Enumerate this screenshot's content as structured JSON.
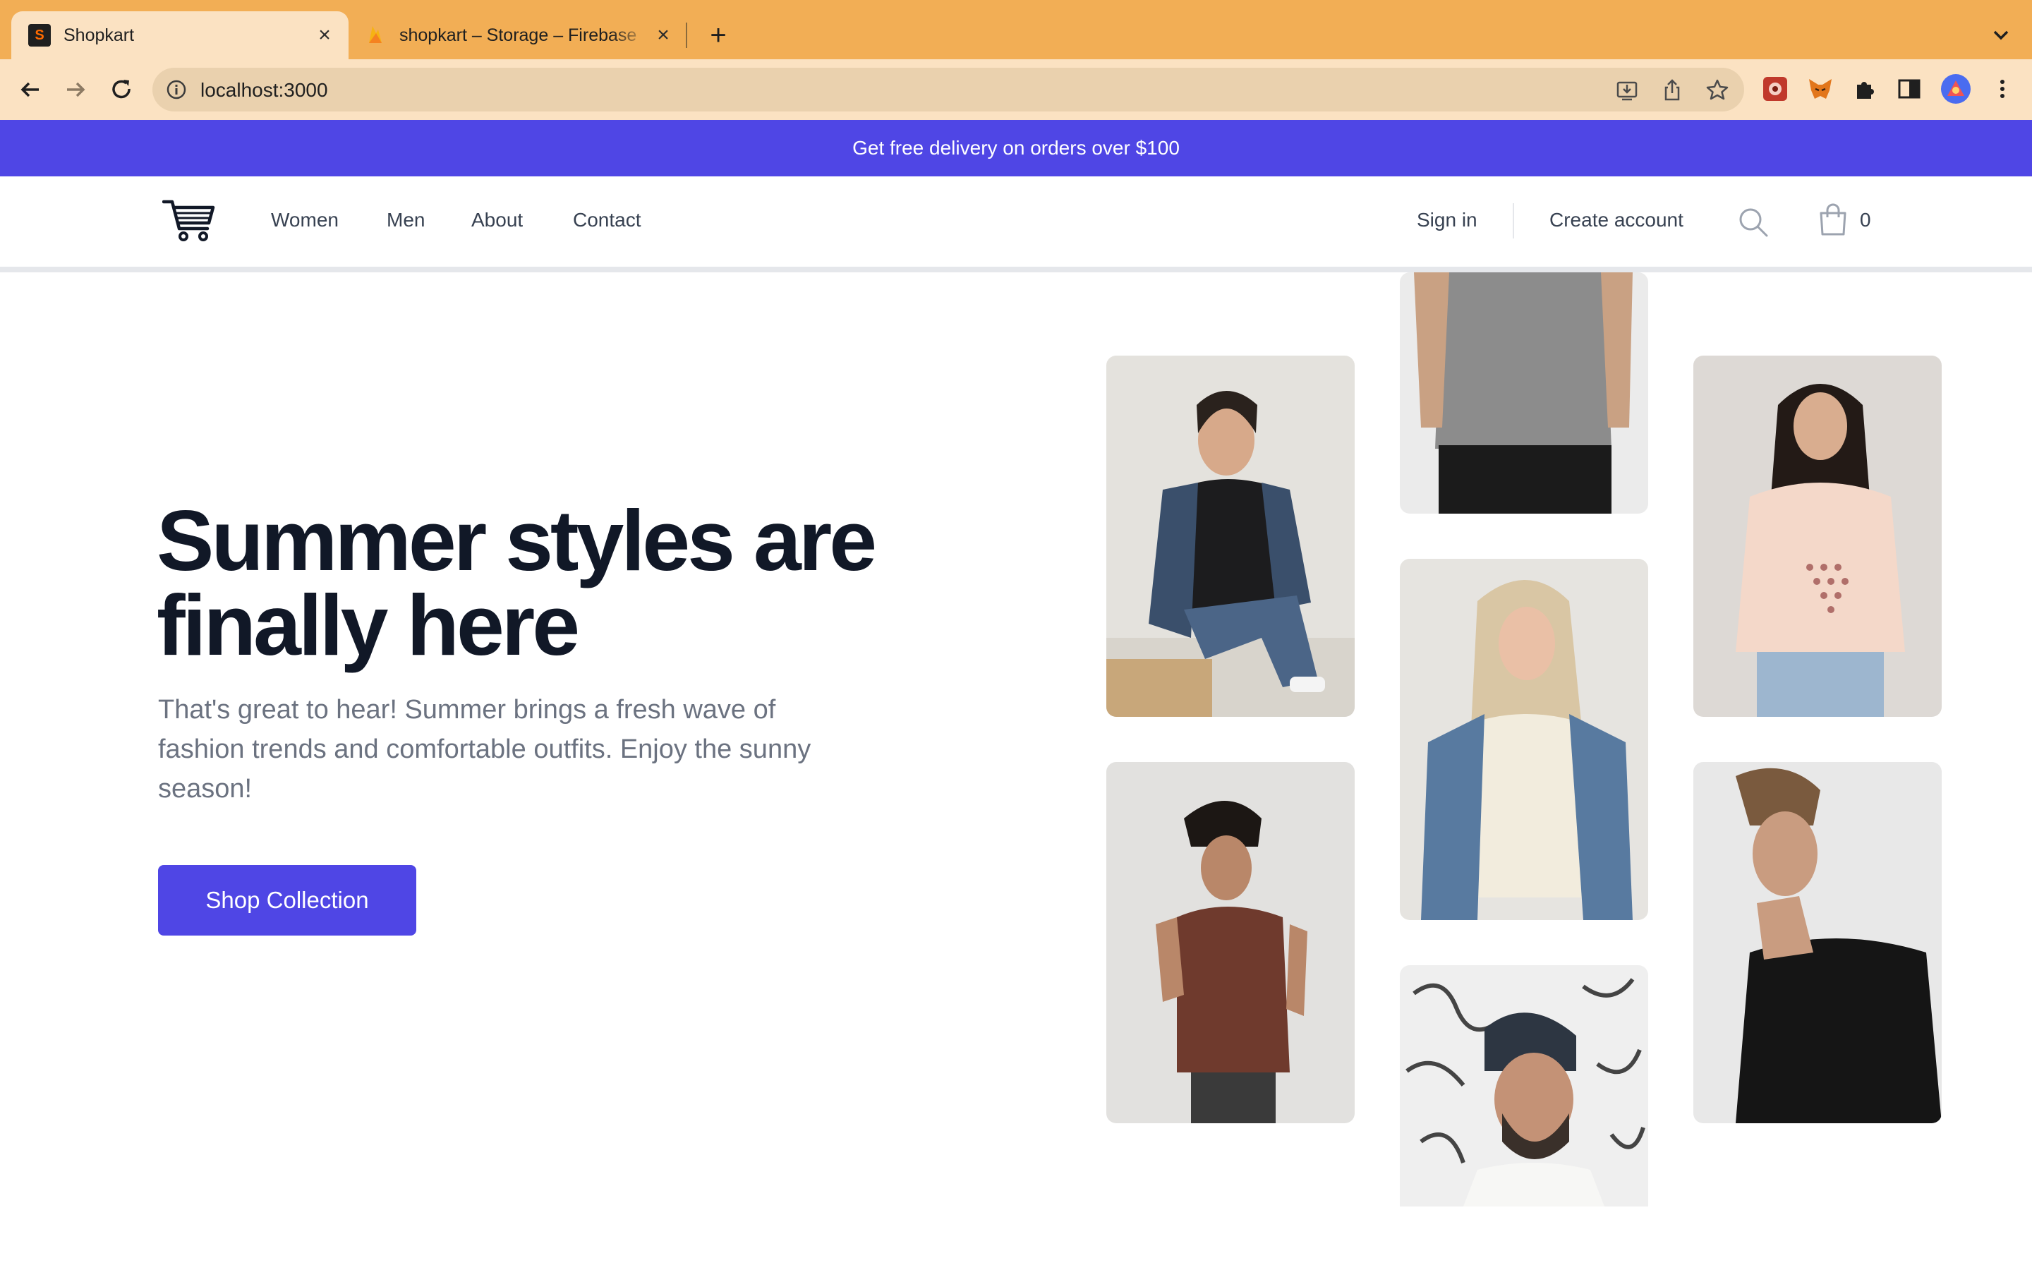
{
  "browser": {
    "tabs": [
      {
        "title": "Shopkart",
        "favicon": "S",
        "active": true
      },
      {
        "title": "shopkart – Storage – Firebase",
        "favicon": "firebase-flame",
        "active": false
      }
    ],
    "url": "localhost:3000",
    "accent_color": "#f2ae55"
  },
  "promo": {
    "text": "Get free delivery on orders over $100"
  },
  "nav": {
    "links": [
      "Women",
      "Men",
      "About",
      "Contact"
    ],
    "sign_in": "Sign in",
    "create_account": "Create account",
    "cart_count": "0"
  },
  "hero": {
    "title": "Summer styles are finally here",
    "description": "That's great to hear! Summer brings a fresh wave of fashion trends and comfortable outfits. Enjoy the sunny season!",
    "cta": "Shop Collection",
    "brand_color": "#4f46e5"
  },
  "gallery": {
    "images": [
      "woman-denim-jacket-photo",
      "man-gray-tshirt-photo",
      "woman-pink-tshirt-photo",
      "woman-cream-tshirt-denim-photo",
      "man-brown-tshirt-photo",
      "man-black-tshirt-photo",
      "man-beanie-glasses-photo"
    ]
  }
}
